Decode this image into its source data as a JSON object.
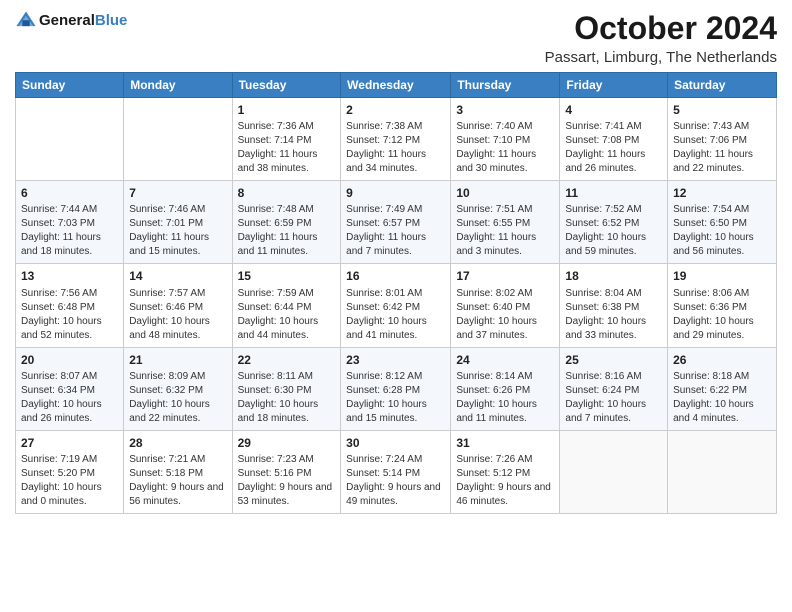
{
  "header": {
    "logo_general": "General",
    "logo_blue": "Blue",
    "month_title": "October 2024",
    "location": "Passart, Limburg, The Netherlands"
  },
  "weekdays": [
    "Sunday",
    "Monday",
    "Tuesday",
    "Wednesday",
    "Thursday",
    "Friday",
    "Saturday"
  ],
  "weeks": [
    [
      {
        "day": "",
        "sunrise": "",
        "sunset": "",
        "daylight": ""
      },
      {
        "day": "",
        "sunrise": "",
        "sunset": "",
        "daylight": ""
      },
      {
        "day": "1",
        "sunrise": "Sunrise: 7:36 AM",
        "sunset": "Sunset: 7:14 PM",
        "daylight": "Daylight: 11 hours and 38 minutes."
      },
      {
        "day": "2",
        "sunrise": "Sunrise: 7:38 AM",
        "sunset": "Sunset: 7:12 PM",
        "daylight": "Daylight: 11 hours and 34 minutes."
      },
      {
        "day": "3",
        "sunrise": "Sunrise: 7:40 AM",
        "sunset": "Sunset: 7:10 PM",
        "daylight": "Daylight: 11 hours and 30 minutes."
      },
      {
        "day": "4",
        "sunrise": "Sunrise: 7:41 AM",
        "sunset": "Sunset: 7:08 PM",
        "daylight": "Daylight: 11 hours and 26 minutes."
      },
      {
        "day": "5",
        "sunrise": "Sunrise: 7:43 AM",
        "sunset": "Sunset: 7:06 PM",
        "daylight": "Daylight: 11 hours and 22 minutes."
      }
    ],
    [
      {
        "day": "6",
        "sunrise": "Sunrise: 7:44 AM",
        "sunset": "Sunset: 7:03 PM",
        "daylight": "Daylight: 11 hours and 18 minutes."
      },
      {
        "day": "7",
        "sunrise": "Sunrise: 7:46 AM",
        "sunset": "Sunset: 7:01 PM",
        "daylight": "Daylight: 11 hours and 15 minutes."
      },
      {
        "day": "8",
        "sunrise": "Sunrise: 7:48 AM",
        "sunset": "Sunset: 6:59 PM",
        "daylight": "Daylight: 11 hours and 11 minutes."
      },
      {
        "day": "9",
        "sunrise": "Sunrise: 7:49 AM",
        "sunset": "Sunset: 6:57 PM",
        "daylight": "Daylight: 11 hours and 7 minutes."
      },
      {
        "day": "10",
        "sunrise": "Sunrise: 7:51 AM",
        "sunset": "Sunset: 6:55 PM",
        "daylight": "Daylight: 11 hours and 3 minutes."
      },
      {
        "day": "11",
        "sunrise": "Sunrise: 7:52 AM",
        "sunset": "Sunset: 6:52 PM",
        "daylight": "Daylight: 10 hours and 59 minutes."
      },
      {
        "day": "12",
        "sunrise": "Sunrise: 7:54 AM",
        "sunset": "Sunset: 6:50 PM",
        "daylight": "Daylight: 10 hours and 56 minutes."
      }
    ],
    [
      {
        "day": "13",
        "sunrise": "Sunrise: 7:56 AM",
        "sunset": "Sunset: 6:48 PM",
        "daylight": "Daylight: 10 hours and 52 minutes."
      },
      {
        "day": "14",
        "sunrise": "Sunrise: 7:57 AM",
        "sunset": "Sunset: 6:46 PM",
        "daylight": "Daylight: 10 hours and 48 minutes."
      },
      {
        "day": "15",
        "sunrise": "Sunrise: 7:59 AM",
        "sunset": "Sunset: 6:44 PM",
        "daylight": "Daylight: 10 hours and 44 minutes."
      },
      {
        "day": "16",
        "sunrise": "Sunrise: 8:01 AM",
        "sunset": "Sunset: 6:42 PM",
        "daylight": "Daylight: 10 hours and 41 minutes."
      },
      {
        "day": "17",
        "sunrise": "Sunrise: 8:02 AM",
        "sunset": "Sunset: 6:40 PM",
        "daylight": "Daylight: 10 hours and 37 minutes."
      },
      {
        "day": "18",
        "sunrise": "Sunrise: 8:04 AM",
        "sunset": "Sunset: 6:38 PM",
        "daylight": "Daylight: 10 hours and 33 minutes."
      },
      {
        "day": "19",
        "sunrise": "Sunrise: 8:06 AM",
        "sunset": "Sunset: 6:36 PM",
        "daylight": "Daylight: 10 hours and 29 minutes."
      }
    ],
    [
      {
        "day": "20",
        "sunrise": "Sunrise: 8:07 AM",
        "sunset": "Sunset: 6:34 PM",
        "daylight": "Daylight: 10 hours and 26 minutes."
      },
      {
        "day": "21",
        "sunrise": "Sunrise: 8:09 AM",
        "sunset": "Sunset: 6:32 PM",
        "daylight": "Daylight: 10 hours and 22 minutes."
      },
      {
        "day": "22",
        "sunrise": "Sunrise: 8:11 AM",
        "sunset": "Sunset: 6:30 PM",
        "daylight": "Daylight: 10 hours and 18 minutes."
      },
      {
        "day": "23",
        "sunrise": "Sunrise: 8:12 AM",
        "sunset": "Sunset: 6:28 PM",
        "daylight": "Daylight: 10 hours and 15 minutes."
      },
      {
        "day": "24",
        "sunrise": "Sunrise: 8:14 AM",
        "sunset": "Sunset: 6:26 PM",
        "daylight": "Daylight: 10 hours and 11 minutes."
      },
      {
        "day": "25",
        "sunrise": "Sunrise: 8:16 AM",
        "sunset": "Sunset: 6:24 PM",
        "daylight": "Daylight: 10 hours and 7 minutes."
      },
      {
        "day": "26",
        "sunrise": "Sunrise: 8:18 AM",
        "sunset": "Sunset: 6:22 PM",
        "daylight": "Daylight: 10 hours and 4 minutes."
      }
    ],
    [
      {
        "day": "27",
        "sunrise": "Sunrise: 7:19 AM",
        "sunset": "Sunset: 5:20 PM",
        "daylight": "Daylight: 10 hours and 0 minutes."
      },
      {
        "day": "28",
        "sunrise": "Sunrise: 7:21 AM",
        "sunset": "Sunset: 5:18 PM",
        "daylight": "Daylight: 9 hours and 56 minutes."
      },
      {
        "day": "29",
        "sunrise": "Sunrise: 7:23 AM",
        "sunset": "Sunset: 5:16 PM",
        "daylight": "Daylight: 9 hours and 53 minutes."
      },
      {
        "day": "30",
        "sunrise": "Sunrise: 7:24 AM",
        "sunset": "Sunset: 5:14 PM",
        "daylight": "Daylight: 9 hours and 49 minutes."
      },
      {
        "day": "31",
        "sunrise": "Sunrise: 7:26 AM",
        "sunset": "Sunset: 5:12 PM",
        "daylight": "Daylight: 9 hours and 46 minutes."
      },
      {
        "day": "",
        "sunrise": "",
        "sunset": "",
        "daylight": ""
      },
      {
        "day": "",
        "sunrise": "",
        "sunset": "",
        "daylight": ""
      }
    ]
  ]
}
